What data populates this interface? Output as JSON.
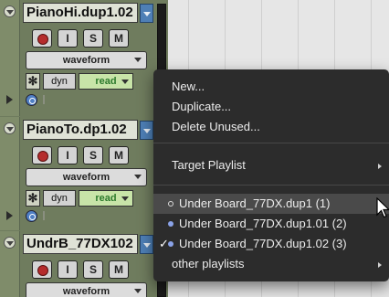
{
  "tracks": [
    {
      "name": "PianoHi.dup1.02",
      "buttons": {
        "rec": "",
        "input": "I",
        "solo": "S",
        "mute": "M"
      },
      "view": "waveform",
      "automation": {
        "symbol": "✻",
        "mode_dyn": "dyn",
        "mode": "read"
      }
    },
    {
      "name": "PianoTo.dp1.02",
      "buttons": {
        "rec": "",
        "input": "I",
        "solo": "S",
        "mute": "M"
      },
      "view": "waveform",
      "automation": {
        "symbol": "✻",
        "mode_dyn": "dyn",
        "mode": "read"
      }
    },
    {
      "name": "UndrB_77DX102",
      "buttons": {
        "rec": "",
        "input": "I",
        "solo": "S",
        "mute": "M"
      },
      "view": "waveform"
    }
  ],
  "menu": {
    "new": "New...",
    "duplicate": "Duplicate...",
    "delete_unused": "Delete Unused...",
    "target_playlist": "Target Playlist",
    "playlists": [
      {
        "label": "Under Board_77DX.dup1 (1)",
        "marker": "circle",
        "highlighted": true,
        "checked": false
      },
      {
        "label": "Under Board_77DX.dup1.01 (2)",
        "marker": "dot",
        "highlighted": false,
        "checked": false
      },
      {
        "label": "Under Board_77DX.dup1.02 (3)",
        "marker": "dot",
        "highlighted": false,
        "checked": true,
        "check": "✓"
      }
    ],
    "other_playlists": "other playlists"
  },
  "colors": {
    "track_bg": "#6f7c5e",
    "menu_bg": "#2c2c2c",
    "menu_highlight": "#4a4a4a",
    "read_mode_text": "#2c7a2c",
    "rec_red": "#b52c2c",
    "playlist_button": "#4e7fb6"
  }
}
